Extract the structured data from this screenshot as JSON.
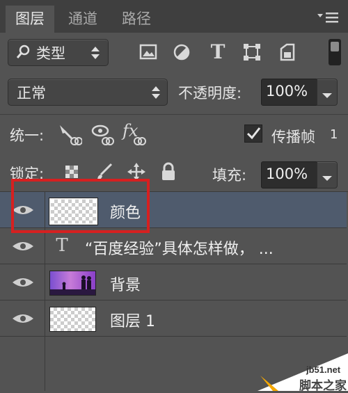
{
  "tabs": [
    {
      "label": "图层",
      "active": true
    },
    {
      "label": "通道",
      "active": false
    },
    {
      "label": "路径",
      "active": false
    }
  ],
  "panel_menu_icon": "panel-menu-icon",
  "filter": {
    "search_icon": "search-icon",
    "kind_label": "类型",
    "stepper": "⬍"
  },
  "blend": {
    "mode": "正常",
    "opacity_label": "不透明度:",
    "opacity_value": "100%"
  },
  "unify": {
    "label": "统一:",
    "propagate_label": "传播帧",
    "propagate_value": "1"
  },
  "lock": {
    "label": "锁定:",
    "fill_label": "填充:",
    "fill_value": "100%"
  },
  "layers": [
    {
      "name": "颜色",
      "selected": true,
      "type": "pixel"
    },
    {
      "name": "“百度经验”具体怎样做， ...",
      "selected": false,
      "type": "text",
      "type_glyph": "T"
    },
    {
      "name": "背景",
      "selected": false,
      "type": "image"
    },
    {
      "name": "图层 1",
      "selected": false,
      "type": "pixel"
    }
  ],
  "watermark": {
    "site": "jb51.net",
    "name": "脚本之家"
  },
  "colors": {
    "panel": "#535353",
    "selected_row": "#4f5b6d",
    "highlight_box": "#d62020"
  }
}
